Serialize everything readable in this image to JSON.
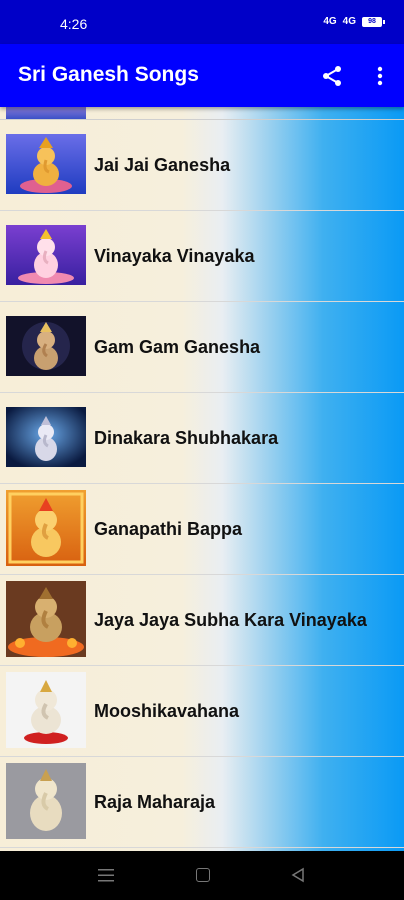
{
  "status_bar": {
    "time": "4:26",
    "network_1": "4G",
    "network_2": "4G",
    "battery": "98"
  },
  "app_bar": {
    "title": "Sri Ganesh Songs",
    "share_icon": "share-icon",
    "more_icon": "more-vert-icon",
    "color": "#0000ff"
  },
  "songs": [
    {
      "title": "Jai Jai Ganesha"
    },
    {
      "title": "Vinayaka Vinayaka"
    },
    {
      "title": "Gam Gam Ganesha"
    },
    {
      "title": "Dinakara Shubhakara"
    },
    {
      "title": "Ganapathi Bappa"
    },
    {
      "title": "Jaya Jaya Subha Kara Vinayaka"
    },
    {
      "title": "Mooshikavahana"
    },
    {
      "title": "Raja Maharaja"
    }
  ],
  "nav_bar": {
    "menu_icon": "menu-icon",
    "home_icon": "home-square-icon",
    "back_icon": "back-triangle-icon"
  }
}
